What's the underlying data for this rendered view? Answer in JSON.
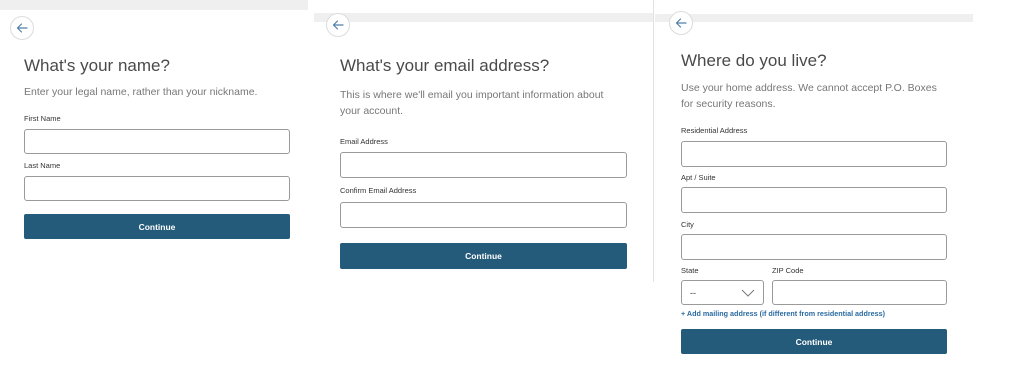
{
  "name_step": {
    "title": "What's your name?",
    "subtitle": "Enter your legal name, rather than your nickname.",
    "first_name_label": "First Name",
    "last_name_label": "Last Name",
    "first_name_value": "",
    "last_name_value": "",
    "continue_label": "Continue"
  },
  "email_step": {
    "title": "What's your email address?",
    "subtitle": "This is where we'll email you important information about your account.",
    "email_label": "Email Address",
    "confirm_email_label": "Confirm Email Address",
    "email_value": "",
    "confirm_email_value": "",
    "continue_label": "Continue"
  },
  "address_step": {
    "title": "Where do you live?",
    "subtitle": "Use your home address. We cannot accept P.O. Boxes for security reasons.",
    "residential_label": "Residential Address",
    "apt_label": "Apt / Suite",
    "city_label": "City",
    "state_label": "State",
    "zip_label": "ZIP Code",
    "state_value": "--",
    "residential_value": "",
    "apt_value": "",
    "city_value": "",
    "zip_value": "",
    "mailing_link": "+ Add mailing address (if different from residential address)",
    "continue_label": "Continue"
  },
  "icons": {
    "back": "arrow-left-icon",
    "state_dropdown": "chevron-down-icon"
  },
  "colors": {
    "primary_button": "#245a7a",
    "link": "#2a6aa0",
    "top_bar": "#efefef"
  }
}
